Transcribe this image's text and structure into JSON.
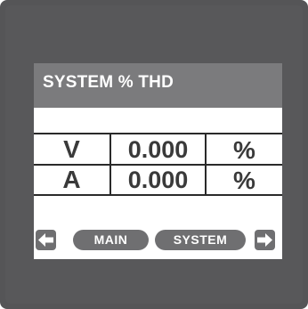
{
  "screen": {
    "title": "SYSTEM % THD"
  },
  "rows": [
    {
      "label": "V",
      "value": "0.000",
      "unit": "%"
    },
    {
      "label": "A",
      "value": "0.000",
      "unit": "%"
    }
  ],
  "nav": {
    "main_label": "MAIN",
    "system_label": "SYSTEM",
    "left_icon": "arrow-left-icon",
    "right_icon": "arrow-right-icon"
  },
  "colors": {
    "bezel": "#555557",
    "title_bar": "#7b7b7d",
    "button": "#6f6f71",
    "text_dark": "#3a3a3a"
  }
}
